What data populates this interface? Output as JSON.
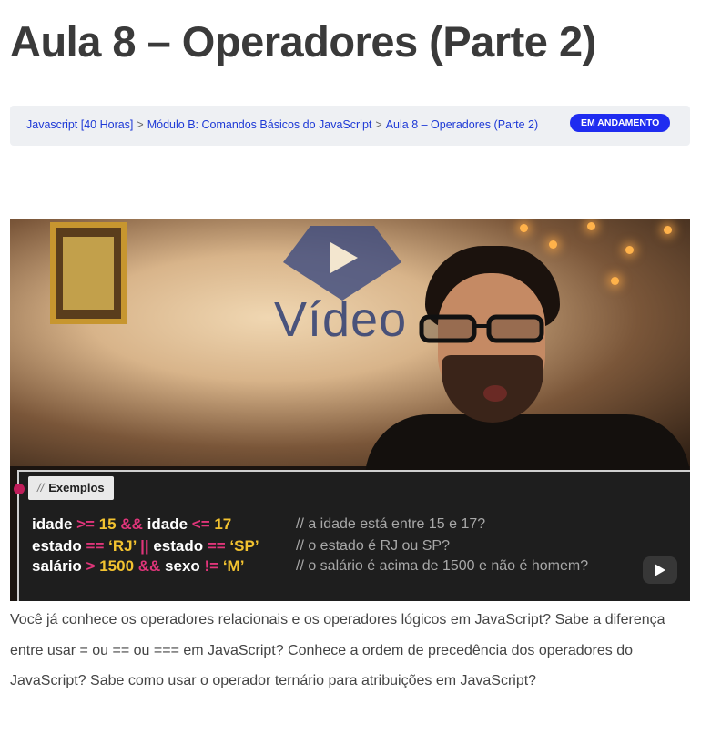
{
  "page": {
    "title": "Aula 8 – Operadores (Parte 2)"
  },
  "breadcrumb": {
    "items": [
      "Javascript [40 Horas]",
      "Módulo B: Comandos Básicos do JavaScript",
      "Aula 8 – Operadores (Parte 2)"
    ],
    "separator": ">",
    "status": "EM ANDAMENTO"
  },
  "video": {
    "logo_text": "Vídeo",
    "panel_tag": "Exemplos",
    "panel_tag_prefix": "//",
    "code_lines": [
      {
        "parts": [
          {
            "text": "idade ",
            "kind": "text"
          },
          {
            "text": ">=",
            "kind": "op"
          },
          {
            "text": " 15 ",
            "kind": "num"
          },
          {
            "text": "&&",
            "kind": "op"
          },
          {
            "text": " idade ",
            "kind": "text"
          },
          {
            "text": "<=",
            "kind": "op"
          },
          {
            "text": " 17",
            "kind": "num"
          }
        ],
        "comment": "// a idade está entre 15 e 17?"
      },
      {
        "parts": [
          {
            "text": "estado ",
            "kind": "text"
          },
          {
            "text": "==",
            "kind": "op"
          },
          {
            "text": " ‘RJ’ ",
            "kind": "num"
          },
          {
            "text": "||",
            "kind": "op"
          },
          {
            "text": " estado ",
            "kind": "text"
          },
          {
            "text": "==",
            "kind": "op"
          },
          {
            "text": " ‘SP’",
            "kind": "num"
          }
        ],
        "comment": "// o estado é RJ ou SP?"
      },
      {
        "parts": [
          {
            "text": "salário ",
            "kind": "text"
          },
          {
            "text": ">",
            "kind": "op"
          },
          {
            "text": " 1500 ",
            "kind": "num"
          },
          {
            "text": "&&",
            "kind": "op"
          },
          {
            "text": " sexo ",
            "kind": "text"
          },
          {
            "text": "!=",
            "kind": "op"
          },
          {
            "text": " ‘M’",
            "kind": "num"
          }
        ],
        "comment": "// o salário é acima de 1500 e não é homem?"
      }
    ],
    "play_icon": "play-icon"
  },
  "description": "Você já conhece os operadores relacionais e os operadores lógicos em JavaScript? Sabe a diferença entre usar = ou == ou === em JavaScript? Conhece a ordem de precedência dos operadores do JavaScript? Sabe como usar o operador ternário para atribuições em JavaScript?",
  "colors": {
    "link": "#1d39d6",
    "badge": "#1f2cf0",
    "operator": "#e0357a",
    "number": "#f2c230"
  }
}
